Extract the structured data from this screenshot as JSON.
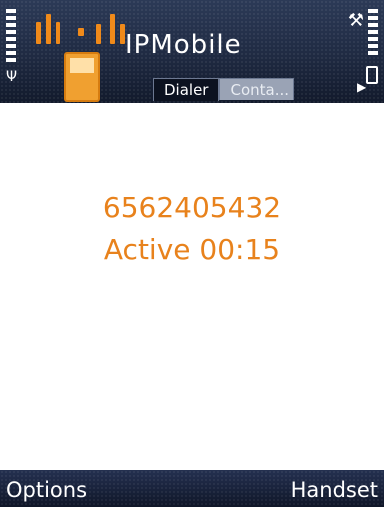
{
  "header": {
    "app_title": "IPMobile",
    "tabs": [
      {
        "label": "Dialer",
        "active": true
      },
      {
        "label": "Conta...",
        "active": false
      }
    ],
    "icons": {
      "signal": "signal-strength-icon",
      "antenna": "antenna-icon",
      "tools": "tools-icon",
      "battery": "battery-level-icon",
      "tab_arrow": "tab-scroll-right-icon",
      "logo": "ipmobile-logo-icon"
    }
  },
  "call": {
    "number": "6562405432",
    "status": "Active 00:15"
  },
  "softkeys": {
    "left": "Options",
    "right": "Handset"
  },
  "colors": {
    "accent": "#e8821c",
    "header_bg": "#1f2a42",
    "softkey_bg": "#121a2c"
  }
}
